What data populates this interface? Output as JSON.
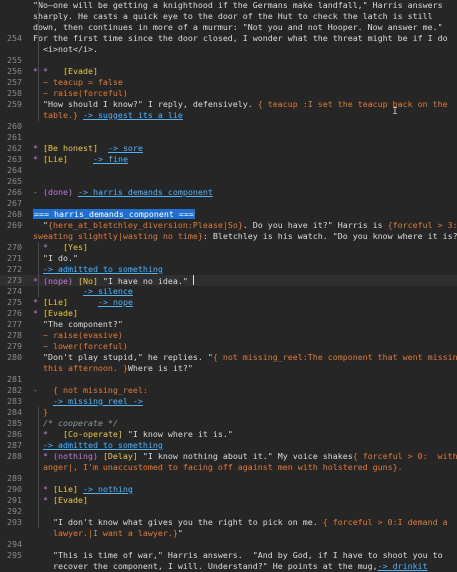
{
  "lines": [
    {
      "n": "",
      "segs": [
        {
          "t": "\"No—one will be getting a knighthood if the Germans make landfall,\" Harris answers",
          "c": "w"
        }
      ]
    },
    {
      "n": "",
      "segs": [
        {
          "t": "sharply. He casts a quick eye to the door of the Hut to check the latch is still",
          "c": "w"
        }
      ]
    },
    {
      "n": "",
      "segs": [
        {
          "t": "down, then continues in more of a murmur: \"Not you and not Hooper. Now answer me.\"",
          "c": "w"
        }
      ]
    },
    {
      "n": "254",
      "segs": [
        {
          "t": "For the first time since the door closed, I wonder what the threat might be if I do",
          "c": "w"
        }
      ]
    },
    {
      "n": "",
      "segs": [
        {
          "t": "  <i>not</i>.",
          "c": "w"
        }
      ]
    },
    {
      "n": "255",
      "segs": []
    },
    {
      "n": "256",
      "segs": [
        {
          "t": "* *   ",
          "c": "m"
        },
        {
          "t": "[Evade]",
          "c": "y"
        }
      ]
    },
    {
      "n": "257",
      "segs": [
        {
          "t": "  ~ teacup = false",
          "c": "o"
        }
      ]
    },
    {
      "n": "258",
      "segs": [
        {
          "t": "  ~ raise(forceful)",
          "c": "o"
        }
      ]
    },
    {
      "n": "259",
      "segs": [
        {
          "t": "  \"How should I know?\" I reply, defensively. ",
          "c": "w"
        },
        {
          "t": "{ teacup :I set the teacup back on the",
          "c": "o"
        }
      ]
    },
    {
      "n": "",
      "segs": [
        {
          "t": "  table.} ",
          "c": "o"
        },
        {
          "t": "-> suggest its a lie",
          "c": "l"
        }
      ]
    },
    {
      "n": "260",
      "segs": []
    },
    {
      "n": "261",
      "segs": []
    },
    {
      "n": "262",
      "segs": [
        {
          "t": "* ",
          "c": "m"
        },
        {
          "t": "[Be honest]",
          "c": "y"
        },
        {
          "t": "  ",
          "c": "w"
        },
        {
          "t": "-> sore",
          "c": "l"
        }
      ]
    },
    {
      "n": "263",
      "segs": [
        {
          "t": "* ",
          "c": "m"
        },
        {
          "t": "[Lie]",
          "c": "y"
        },
        {
          "t": "     ",
          "c": "w"
        },
        {
          "t": "-> fine",
          "c": "l"
        }
      ]
    },
    {
      "n": "264",
      "segs": []
    },
    {
      "n": "265",
      "segs": []
    },
    {
      "n": "266",
      "segs": [
        {
          "t": "- (done) ",
          "c": "m"
        },
        {
          "t": "-> harris demands component",
          "c": "l"
        }
      ]
    },
    {
      "n": "267",
      "segs": []
    },
    {
      "n": "268",
      "segs": [
        {
          "t": "=== harris_demands_component ===",
          "c": "sec"
        }
      ]
    },
    {
      "n": "269",
      "segs": [
        {
          "t": "  \"",
          "c": "w"
        },
        {
          "t": "{here_at_bletchley_diversion:Please|So}",
          "c": "o"
        },
        {
          "t": ". Do you have it?\" Harris is ",
          "c": "w"
        },
        {
          "t": "{forceful > 3:",
          "c": "o"
        }
      ]
    },
    {
      "n": "",
      "segs": [
        {
          "t": "sweating slightly|wasting no time}",
          "c": "o"
        },
        {
          "t": ": Bletchley is his watch. \"Do you know where it is?\"",
          "c": "w"
        }
      ]
    },
    {
      "n": "270",
      "segs": [
        {
          "t": "  *   ",
          "c": "m"
        },
        {
          "t": "[Yes]",
          "c": "y"
        }
      ]
    },
    {
      "n": "271",
      "segs": [
        {
          "t": "  \"I do.\"",
          "c": "w"
        }
      ]
    },
    {
      "n": "272",
      "segs": [
        {
          "t": "  ",
          "c": "w"
        },
        {
          "t": "-> admitted to something",
          "c": "l"
        }
      ]
    },
    {
      "n": "273",
      "segs": [
        {
          "t": "* (nope) ",
          "c": "m"
        },
        {
          "t": "[No]",
          "c": "y"
        },
        {
          "t": " \"I have no idea.\" ",
          "c": "w"
        },
        {
          "t": "CURSOR",
          "c": "cursor"
        }
      ],
      "cur": true
    },
    {
      "n": "274",
      "segs": [
        {
          "t": "          ",
          "c": "w"
        },
        {
          "t": "-> silence",
          "c": "l"
        }
      ]
    },
    {
      "n": "275",
      "segs": [
        {
          "t": "* ",
          "c": "m"
        },
        {
          "t": "[Lie]",
          "c": "y"
        },
        {
          "t": "      ",
          "c": "w"
        },
        {
          "t": "-> nope",
          "c": "l"
        }
      ]
    },
    {
      "n": "276",
      "segs": [
        {
          "t": "* ",
          "c": "m"
        },
        {
          "t": "[Evade]",
          "c": "y"
        }
      ]
    },
    {
      "n": "277",
      "segs": [
        {
          "t": "  \"The component?\"",
          "c": "w"
        }
      ]
    },
    {
      "n": "278",
      "segs": [
        {
          "t": "  ~ raise(evasive)",
          "c": "o"
        }
      ]
    },
    {
      "n": "279",
      "segs": [
        {
          "t": "  ~ lower(forceful)",
          "c": "o"
        }
      ]
    },
    {
      "n": "280",
      "segs": [
        {
          "t": "  \"Don't play stupid,\" he replies. \"",
          "c": "w"
        },
        {
          "t": "{ not missing_reel:The component that went missing",
          "c": "o"
        }
      ]
    },
    {
      "n": "",
      "segs": [
        {
          "t": "  this afternoon. }",
          "c": "o"
        },
        {
          "t": "Where is it?\"",
          "c": "w"
        }
      ]
    },
    {
      "n": "281",
      "segs": []
    },
    {
      "n": "282",
      "segs": [
        {
          "t": "-   ",
          "c": "m"
        },
        {
          "t": "{ not missing_reel:",
          "c": "o"
        }
      ]
    },
    {
      "n": "283",
      "segs": [
        {
          "t": "    ",
          "c": "w"
        },
        {
          "t": "-> missing reel ->",
          "c": "l"
        }
      ]
    },
    {
      "n": "284",
      "segs": [
        {
          "t": "  }",
          "c": "o"
        }
      ]
    },
    {
      "n": "285",
      "segs": [
        {
          "t": "  /* cooperate */",
          "c": "cm"
        }
      ]
    },
    {
      "n": "286",
      "segs": [
        {
          "t": "  *   ",
          "c": "m"
        },
        {
          "t": "[Co-operate]",
          "c": "y"
        },
        {
          "t": " \"I know where it is.\"",
          "c": "w"
        }
      ]
    },
    {
      "n": "287",
      "segs": [
        {
          "t": "  ",
          "c": "w"
        },
        {
          "t": "-> admitted to something",
          "c": "l"
        }
      ]
    },
    {
      "n": "288",
      "segs": [
        {
          "t": "  * (nothing) ",
          "c": "m"
        },
        {
          "t": "[Delay]",
          "c": "y"
        },
        {
          "t": " \"I know nothing about it.\" My voice shakes",
          "c": "w"
        },
        {
          "t": "{ forceful > 0:  with",
          "c": "o"
        }
      ]
    },
    {
      "n": "",
      "segs": [
        {
          "t": "  anger|, I'm unaccustomed to facing off against men with holstered guns}.",
          "c": "o"
        }
      ]
    },
    {
      "n": "289",
      "segs": []
    },
    {
      "n": "290",
      "segs": [
        {
          "t": "  * ",
          "c": "m"
        },
        {
          "t": "[Lie]",
          "c": "y"
        },
        {
          "t": " ",
          "c": "w"
        },
        {
          "t": "-> nothing",
          "c": "l"
        }
      ]
    },
    {
      "n": "291",
      "segs": [
        {
          "t": "  * ",
          "c": "m"
        },
        {
          "t": "[Evade]",
          "c": "y"
        }
      ]
    },
    {
      "n": "292",
      "segs": []
    },
    {
      "n": "293",
      "segs": [
        {
          "t": "    \"I don't know what gives you the right to pick on me. ",
          "c": "w"
        },
        {
          "t": "{ forceful > 0:I demand a",
          "c": "o"
        }
      ]
    },
    {
      "n": "",
      "segs": [
        {
          "t": "    lawyer.|I want a lawyer.}",
          "c": "o"
        },
        {
          "t": "\"",
          "c": "w"
        }
      ]
    },
    {
      "n": "294",
      "segs": []
    },
    {
      "n": "295",
      "segs": [
        {
          "t": "    \"This is time of war,\" Harris answers.  \"And by God, if I have to shoot you to",
          "c": "w"
        }
      ]
    },
    {
      "n": "",
      "segs": [
        {
          "t": "    recover the component, I will. Understand?\" He points at the mug,",
          "c": "w"
        },
        {
          "t": "-> drinkit",
          "c": "l"
        }
      ]
    }
  ]
}
